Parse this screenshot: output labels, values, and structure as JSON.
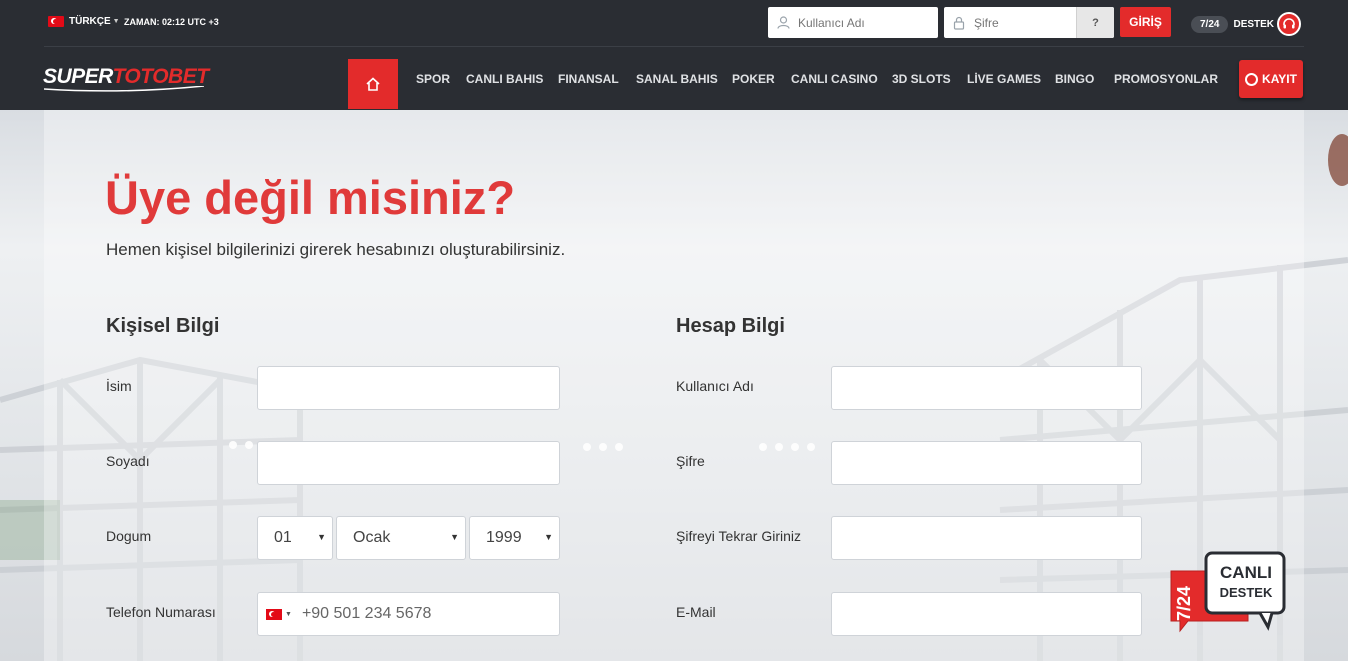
{
  "topbar": {
    "language": "TÜRKÇE",
    "clock": "ZAMAN: 02:12 UTC +3",
    "username_placeholder": "Kullanıcı Adı",
    "password_placeholder": "Şifre",
    "help_label": "?",
    "login_label": "GİRİŞ",
    "support_hours": "7/24",
    "support_label": "DESTEK"
  },
  "brand": {
    "logo_part1": "SUPER",
    "logo_part2": "TOTOBET"
  },
  "nav": {
    "items": [
      "SPOR",
      "CANLI BAHIS",
      "FINANSAL",
      "SANAL BAHIS",
      "POKER",
      "CANLI CASINO",
      "3D SLOTS",
      "LİVE GAMES",
      "BINGO",
      "PROMOSYONLAR"
    ],
    "register_label": "KAYIT"
  },
  "form": {
    "headline": "Üye değil misiniz?",
    "subline": "Hemen kişisel bilgilerinizi girerek hesabınızı oluşturabilirsiniz.",
    "personal_title": "Kişisel Bilgi",
    "account_title": "Hesap Bilgi",
    "labels": {
      "name": "İsim",
      "surname": "Soyadı",
      "birth": "Dogum",
      "phone": "Telefon Numarası",
      "username": "Kullanıcı Adı",
      "password": "Şifre",
      "password_repeat": "Şifreyi Tekrar Giriniz",
      "email": "E-Mail"
    },
    "birth_day": "01",
    "birth_month": "Ocak",
    "birth_year": "1999",
    "phone_placeholder": "+90 501 234 5678"
  },
  "live_support": {
    "hours": "7/24",
    "line1": "CANLI",
    "line2": "DESTEK"
  },
  "colors": {
    "accent": "#e32b2b",
    "header_bg": "#2a2d33",
    "headline": "#e03a3a"
  }
}
